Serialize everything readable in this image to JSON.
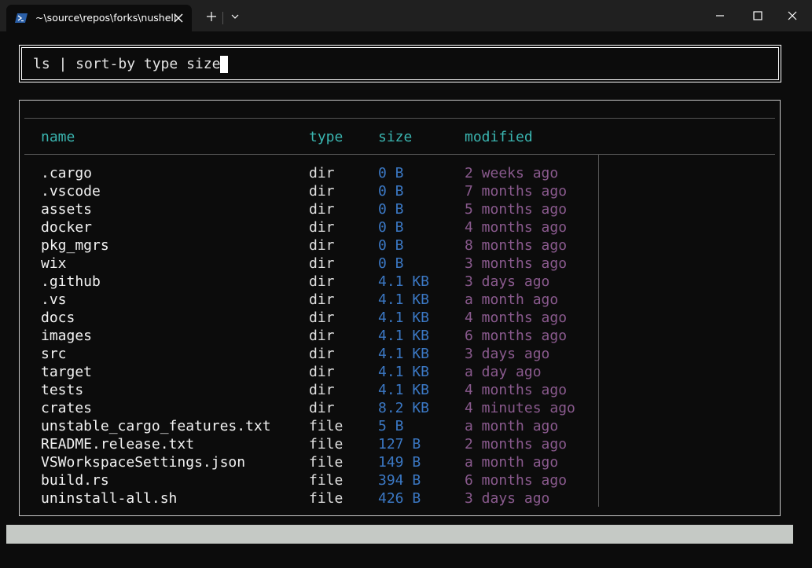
{
  "colors": {
    "background": "#0c0c0c",
    "titlebar": "#202020",
    "header": "#3ab5b0",
    "name": "#f2f2f2",
    "type": "#e0e0e0",
    "size": "#3b78c4",
    "modified": "#8a5a8e",
    "status_bar": "#c5c9c5"
  },
  "titlebar": {
    "tab_title": "~\\source\\repos\\forks\\nushell",
    "tab_icon": "powershell-icon"
  },
  "command": {
    "text": "ls | sort-by type size"
  },
  "table": {
    "headers": {
      "name": "name",
      "type": "type",
      "size": "size",
      "modified": "modified"
    },
    "rows": [
      {
        "name": ".cargo",
        "type": "dir",
        "size": "0 B",
        "modified": "2 weeks ago"
      },
      {
        "name": ".vscode",
        "type": "dir",
        "size": "0 B",
        "modified": "7 months ago"
      },
      {
        "name": "assets",
        "type": "dir",
        "size": "0 B",
        "modified": "5 months ago"
      },
      {
        "name": "docker",
        "type": "dir",
        "size": "0 B",
        "modified": "4 months ago"
      },
      {
        "name": "pkg_mgrs",
        "type": "dir",
        "size": "0 B",
        "modified": "8 months ago"
      },
      {
        "name": "wix",
        "type": "dir",
        "size": "0 B",
        "modified": "3 months ago"
      },
      {
        "name": ".github",
        "type": "dir",
        "size": "4.1 KB",
        "modified": "3 days ago"
      },
      {
        "name": ".vs",
        "type": "dir",
        "size": "4.1 KB",
        "modified": "a month ago"
      },
      {
        "name": "docs",
        "type": "dir",
        "size": "4.1 KB",
        "modified": "4 months ago"
      },
      {
        "name": "images",
        "type": "dir",
        "size": "4.1 KB",
        "modified": "6 months ago"
      },
      {
        "name": "src",
        "type": "dir",
        "size": "4.1 KB",
        "modified": "3 days ago"
      },
      {
        "name": "target",
        "type": "dir",
        "size": "4.1 KB",
        "modified": "a day ago"
      },
      {
        "name": "tests",
        "type": "dir",
        "size": "4.1 KB",
        "modified": "4 months ago"
      },
      {
        "name": "crates",
        "type": "dir",
        "size": "8.2 KB",
        "modified": "4 minutes ago"
      },
      {
        "name": "unstable_cargo_features.txt",
        "type": "file",
        "size": "5 B",
        "modified": "a month ago"
      },
      {
        "name": "README.release.txt",
        "type": "file",
        "size": "127 B",
        "modified": "2 months ago"
      },
      {
        "name": "VSWorkspaceSettings.json",
        "type": "file",
        "size": "149 B",
        "modified": "a month ago"
      },
      {
        "name": "build.rs",
        "type": "file",
        "size": "394 B",
        "modified": "6 months ago"
      },
      {
        "name": "uninstall-all.sh",
        "type": "file",
        "size": "426 B",
        "modified": "3 days ago"
      }
    ]
  }
}
